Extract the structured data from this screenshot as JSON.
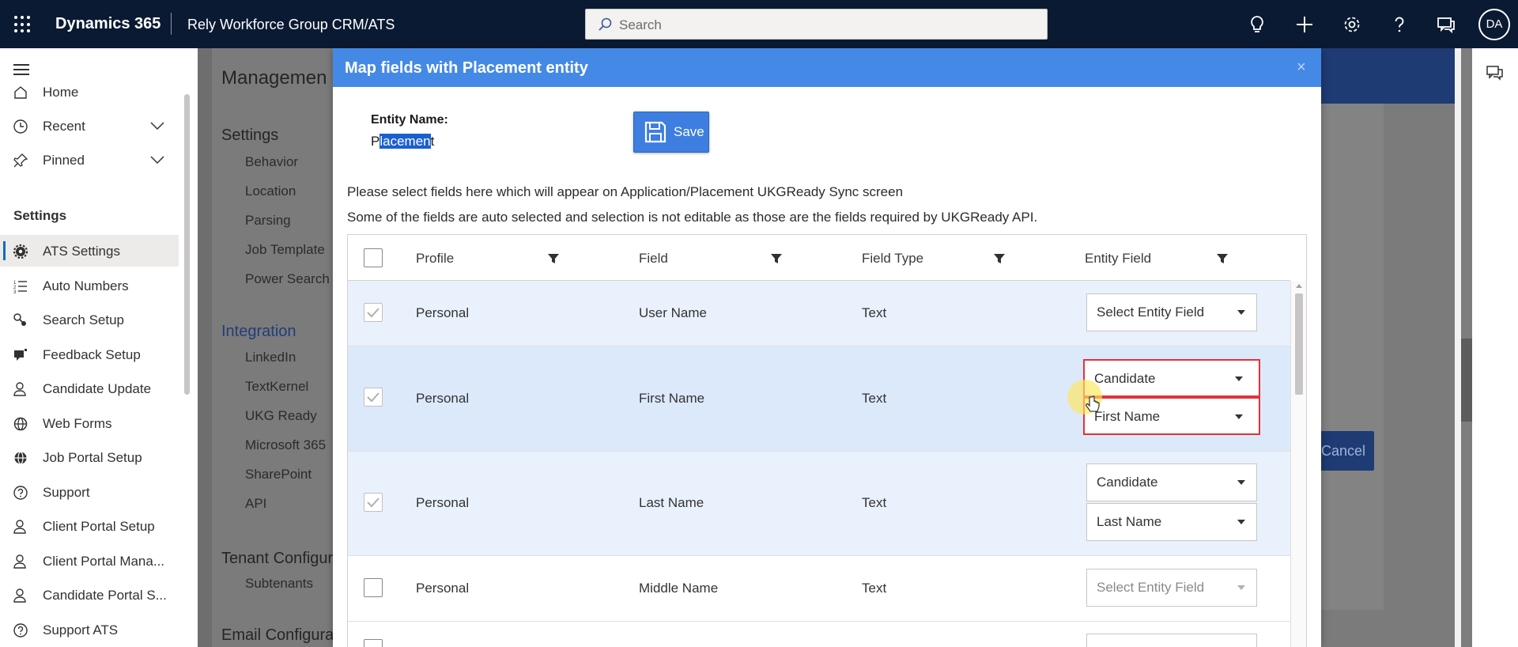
{
  "topbar": {
    "brand": "Dynamics 365",
    "app_name": "Rely Workforce Group CRM/ATS",
    "search_placeholder": "Search",
    "avatar_initials": "DA",
    "icons": [
      "waffle-icon",
      "lightbulb-icon",
      "plus-icon",
      "settings-icon",
      "help-icon",
      "chat-icon"
    ]
  },
  "leftnav": {
    "items_top": [
      {
        "label": "Home",
        "icon": "home-icon"
      },
      {
        "label": "Recent",
        "icon": "clock-icon"
      },
      {
        "label": "Pinned",
        "icon": "pin-icon"
      }
    ],
    "section": "Settings",
    "items": [
      {
        "label": "ATS Settings",
        "icon": "gear-icon",
        "active": true
      },
      {
        "label": "Auto Numbers",
        "icon": "numbered-list-icon"
      },
      {
        "label": "Search Setup",
        "icon": "search-setup-icon"
      },
      {
        "label": "Feedback Setup",
        "icon": "feedback-icon"
      },
      {
        "label": "Candidate Update",
        "icon": "person-icon"
      },
      {
        "label": "Web Forms",
        "icon": "globe-icon"
      },
      {
        "label": "Job Portal Setup",
        "icon": "globe-icon"
      },
      {
        "label": "Support",
        "icon": "question-icon"
      },
      {
        "label": "Client Portal Setup",
        "icon": "person-icon"
      },
      {
        "label": "Client Portal Mana...",
        "icon": "person-icon"
      },
      {
        "label": "Candidate Portal S...",
        "icon": "person-icon"
      },
      {
        "label": "Support ATS",
        "icon": "question-icon"
      }
    ]
  },
  "background": {
    "title": "Managemen",
    "section_settings": "Settings",
    "settings_links": [
      "Behavior",
      "Location",
      "Parsing",
      "Job Template",
      "Power Search"
    ],
    "section_integration": "Integration",
    "integration_links": [
      "LinkedIn",
      "TextKernel",
      "UKG Ready",
      "Microsoft 365",
      "SharePoint",
      "API"
    ],
    "section_tenant": "Tenant Configur",
    "tenant_links": [
      "Subtenants"
    ],
    "section_email": "Email Configura",
    "cancel_label": "Cancel"
  },
  "modal": {
    "title": "Map fields with Placement entity",
    "close": "×",
    "entity_label": "Entity Name:",
    "entity_value_pre": "P",
    "entity_value_hl": "lacemen",
    "entity_value_post": "t",
    "save_label": "Save",
    "instruction_1": "Please select fields here which will appear on Application/Placement UKGReady Sync screen",
    "instruction_2": "Some of the fields are auto selected and selection is not editable as those are the fields required by UKGReady API.",
    "columns": [
      "Profile",
      "Field",
      "Field Type",
      "Entity Field"
    ],
    "rows": [
      {
        "profile": "Personal",
        "field": "User Name",
        "type": "Text",
        "checked": true,
        "dd1": "Select Entity Field",
        "dd2": null
      },
      {
        "profile": "Personal",
        "field": "First Name",
        "type": "Text",
        "checked": true,
        "dd1": "Candidate",
        "dd2": "First Name"
      },
      {
        "profile": "Personal",
        "field": "Last Name",
        "type": "Text",
        "checked": true,
        "dd1": "Candidate",
        "dd2": "Last Name"
      },
      {
        "profile": "Personal",
        "field": "Middle Name",
        "type": "Text",
        "checked": false,
        "dd1": "Select Entity Field",
        "dd2": null
      }
    ]
  }
}
